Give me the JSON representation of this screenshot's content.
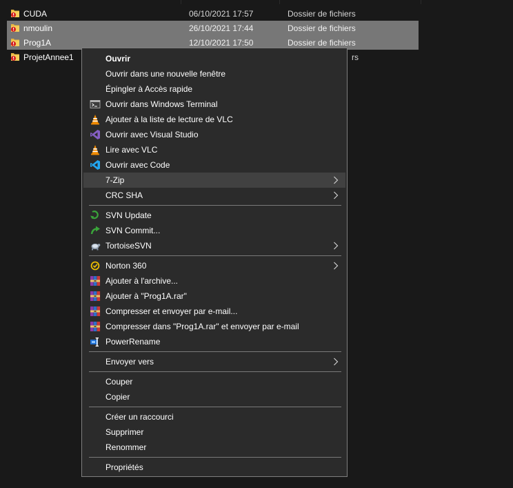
{
  "files": [
    {
      "name": "CUDA",
      "date": "06/10/2021 17:57",
      "type": "Dossier de fichiers",
      "selected": false
    },
    {
      "name": "nmoulin",
      "date": "26/10/2021 17:44",
      "type": "Dossier de fichiers",
      "selected": true
    },
    {
      "name": "Prog1A",
      "date": "12/10/2021 17:50",
      "type": "Dossier de fichiers",
      "selected": true
    },
    {
      "name": "ProjetAnnee1",
      "date": "",
      "type": "rs",
      "selected": false
    }
  ],
  "menu": {
    "open": "Ouvrir",
    "open_new_window": "Ouvrir dans une nouvelle fenêtre",
    "pin_quick_access": "Épingler à Accès rapide",
    "open_terminal": "Ouvrir dans Windows Terminal",
    "add_vlc_playlist": "Ajouter à la liste de lecture de VLC",
    "open_visual_studio": "Ouvrir avec Visual Studio",
    "play_vlc": "Lire avec VLC",
    "open_code": "Ouvrir avec Code",
    "seven_zip": "7-Zip",
    "crc_sha": "CRC SHA",
    "svn_update": "SVN Update",
    "svn_commit": "SVN Commit...",
    "tortoise_svn": "TortoiseSVN",
    "norton": "Norton 360",
    "add_archive": "Ajouter à l'archive...",
    "add_rar": "Ajouter à \"Prog1A.rar\"",
    "compress_email": "Compresser et envoyer par e-mail...",
    "compress_rar_email": "Compresser dans \"Prog1A.rar\" et envoyer par e-mail",
    "power_rename": "PowerRename",
    "send_to": "Envoyer vers",
    "cut": "Couper",
    "copy": "Copier",
    "create_shortcut": "Créer un raccourci",
    "delete": "Supprimer",
    "rename": "Renommer",
    "properties": "Propriétés"
  },
  "colors": {
    "background": "#191919",
    "menu_background": "#2b2b2b",
    "selection": "#777777",
    "hover": "#414141",
    "vlc_orange": "#f08a00",
    "vs_purple": "#865fc5",
    "vscode_blue": "#22a7f2",
    "svn_green": "#3aa53a"
  },
  "icons": {
    "folder": "folder-warning-icon",
    "terminal": "terminal-icon",
    "vlc": "vlc-cone-icon",
    "visual_studio": "visual-studio-icon",
    "vscode": "vscode-icon",
    "svn_update": "svn-update-icon",
    "svn_commit": "svn-commit-icon",
    "tortoise": "tortoise-icon",
    "norton": "norton-check-icon",
    "winrar": "winrar-books-icon",
    "powerrename": "powerrename-icon",
    "submenu": "chevron-right-icon"
  }
}
